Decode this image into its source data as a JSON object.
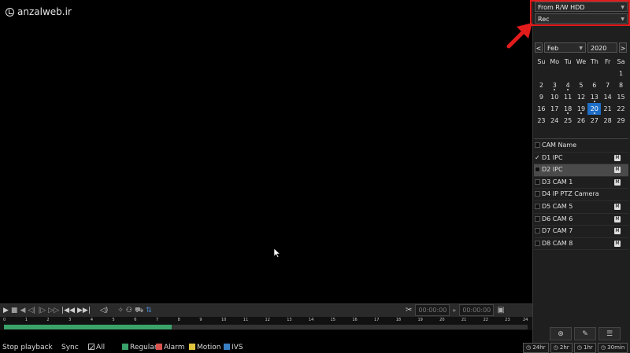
{
  "watermark": "anzalweb.ir",
  "source_select": "From R/W HDD",
  "type_select": "Rec",
  "calendar": {
    "prev": "<",
    "next": ">",
    "month": "Feb",
    "year": "2020",
    "weekdays": [
      "Su",
      "Mo",
      "Tu",
      "We",
      "Th",
      "Fr",
      "Sa"
    ],
    "weeks": [
      [
        "",
        "",
        "",
        "",
        "",
        "",
        "1"
      ],
      [
        "2",
        "3",
        "4",
        "5",
        "6",
        "7",
        "8"
      ],
      [
        "9",
        "10",
        "11",
        "12",
        "13",
        "14",
        "15"
      ],
      [
        "16",
        "17",
        "18",
        "19",
        "20",
        "21",
        "22"
      ],
      [
        "23",
        "24",
        "25",
        "26",
        "27",
        "28",
        "29"
      ]
    ],
    "selected_day": "20",
    "days_with_records": [
      "3",
      "4",
      "13",
      "18",
      "19",
      "20"
    ]
  },
  "camera_list": {
    "header": "CAM Name",
    "items": [
      {
        "label": "D1 IPC",
        "checked": true,
        "badge": "M"
      },
      {
        "label": "D2 IPC",
        "checked": false,
        "badge": "M",
        "active": true
      },
      {
        "label": "D3 CAM 1",
        "checked": false,
        "badge": "M"
      },
      {
        "label": "D4 IP PTZ Camera",
        "checked": false,
        "badge": ""
      },
      {
        "label": "D5 CAM 5",
        "checked": false,
        "badge": "M"
      },
      {
        "label": "D6 CAM 6",
        "checked": false,
        "badge": "M"
      },
      {
        "label": "D7 CAM 7",
        "checked": false,
        "badge": "M"
      },
      {
        "label": "D8 CAM 8",
        "checked": false,
        "badge": "M"
      }
    ]
  },
  "clip_times": {
    "start": "00:00:00",
    "end": "00:00:00"
  },
  "timeline": {
    "hours": [
      "0",
      "1",
      "2",
      "3",
      "4",
      "5",
      "6",
      "7",
      "8",
      "9",
      "10",
      "11",
      "12",
      "13",
      "14",
      "15",
      "16",
      "17",
      "18",
      "19",
      "20",
      "21",
      "22",
      "23",
      "24"
    ],
    "recorded_fraction": 0.32
  },
  "status": {
    "stop": "Stop playback",
    "sync": "Sync",
    "all": "All",
    "regular": "Regular",
    "alarm": "Alarm",
    "motion": "Motion",
    "ivs": "IVS"
  },
  "zoom_levels": [
    "24hr",
    "2hr",
    "1hr",
    "30min"
  ],
  "colors": {
    "regular": "#3aa36a",
    "alarm": "#d9534f",
    "motion": "#e0c341",
    "ivs": "#3a7fc4",
    "highlight": "#e21b1b",
    "selected_day": "#1e6ec8"
  }
}
